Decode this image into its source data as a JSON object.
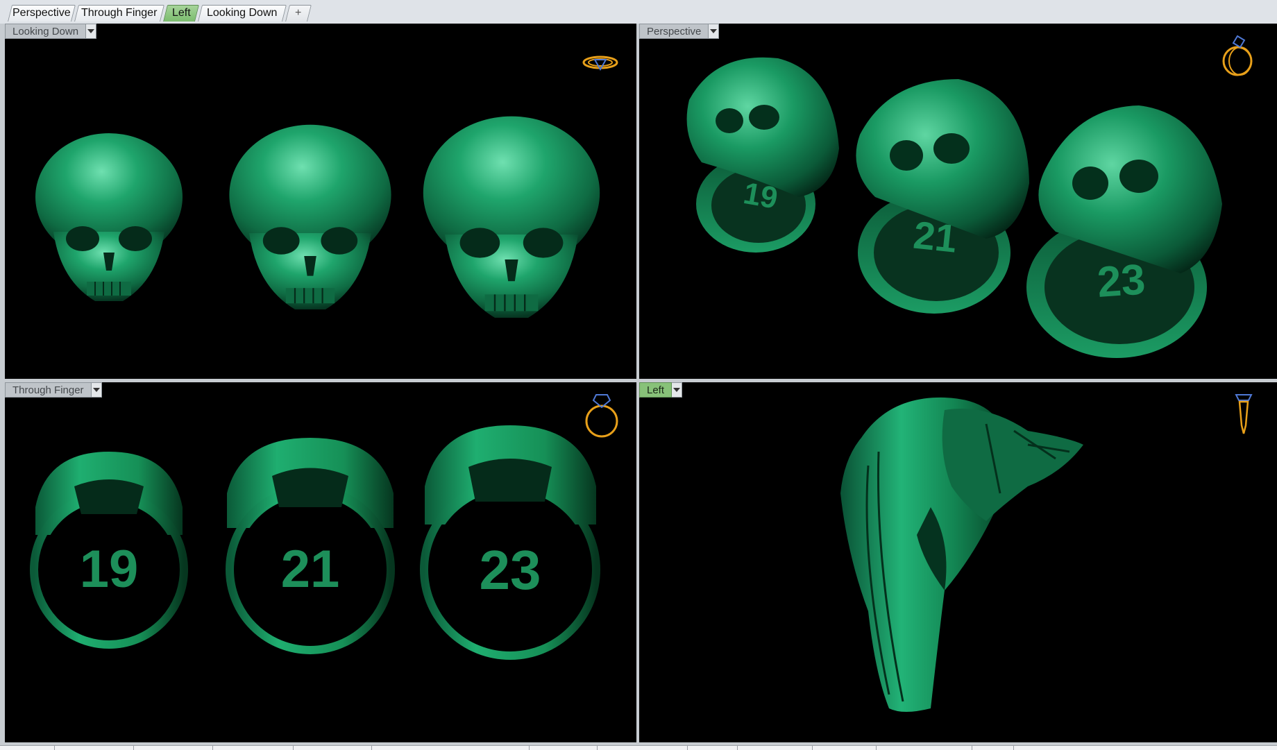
{
  "tabs": [
    {
      "label": "Perspective",
      "active": false
    },
    {
      "label": "Through Finger",
      "active": false
    },
    {
      "label": "Left",
      "active": true
    },
    {
      "label": "Looking Down",
      "active": false
    }
  ],
  "add_tab_symbol": "+",
  "viewports": {
    "top_left": {
      "label": "Looking Down",
      "gizmo": "ring-top-view-icon"
    },
    "top_right": {
      "label": "Perspective",
      "gizmo": "ring-perspective-icon"
    },
    "bottom_left": {
      "label": "Through Finger",
      "gizmo": "ring-front-view-icon"
    },
    "bottom_right": {
      "label": "Left",
      "gizmo": "ring-side-view-icon",
      "active": true
    }
  },
  "ring_sizes": [
    "19",
    "21",
    "23"
  ],
  "colors": {
    "model_green": "#1a9a63",
    "model_dark": "#0a4a2e",
    "active_tab": "#88c279",
    "gizmo_gold": "#e8a01a",
    "gizmo_blue": "#4f79d6"
  }
}
